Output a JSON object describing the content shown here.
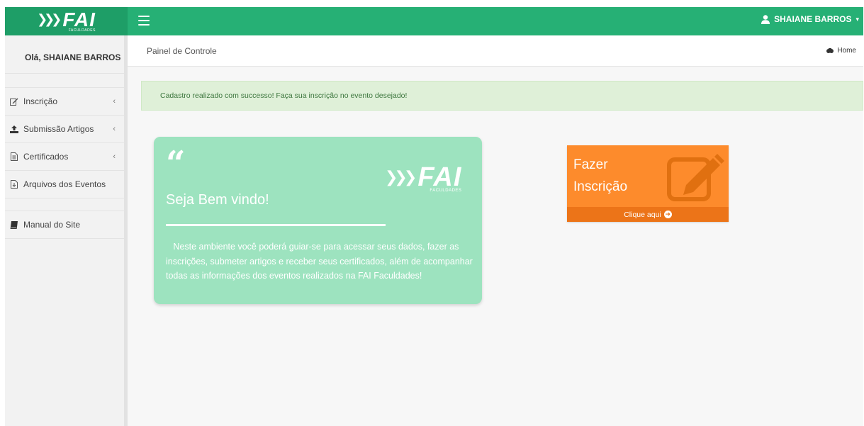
{
  "brand": {
    "logo_text": "FAI",
    "logo_sub": "FACULDADES",
    "colors": {
      "topbar": "#26b075",
      "logo_bg": "#1e9e67",
      "card": "#9de3bf",
      "cta": "#fd8b2c",
      "cta_footer": "#ec7418",
      "alert_bg": "#dff0d8",
      "alert_text": "#3c763d"
    }
  },
  "topbar": {
    "menu_icon": "hamburger-icon",
    "user_name": "SHAIANE BARROS"
  },
  "sidebar": {
    "greeting": "Olá, SHAIANE BARROS",
    "items": [
      {
        "label": "Inscrição",
        "icon": "edit-icon",
        "has_submenu": true
      },
      {
        "label": "Submissão Artigos",
        "icon": "upload-icon",
        "has_submenu": true
      },
      {
        "label": "Certificados",
        "icon": "file-text-icon",
        "has_submenu": true
      },
      {
        "label": "Arquivos dos Eventos",
        "icon": "file-download-icon",
        "has_submenu": false
      }
    ],
    "extra_items": [
      {
        "label": "Manual do Site",
        "icon": "book-icon"
      }
    ]
  },
  "breadcrumb": {
    "title": "Painel de Controle",
    "home_label": "Home"
  },
  "alert": {
    "message": "Cadastro realizado com successo! Faça sua inscrição no evento desejado!"
  },
  "welcome": {
    "quote": "“",
    "title": "Seja Bem vindo!",
    "text": "Neste ambiente você poderá guiar-se para acessar seus dados, fazer as inscrições, submeter artigos e receber seus certificados, além de acompanhar todas as informações dos eventos realizados na FAI Faculdades!"
  },
  "cta": {
    "line1": "Fazer",
    "line2": "Inscrição",
    "footer": "Clique aqui"
  }
}
